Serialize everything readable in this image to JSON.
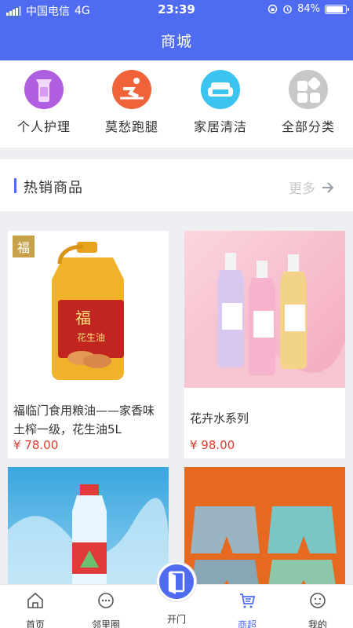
{
  "status_bar": {
    "carrier": "中国电信",
    "network": "4G",
    "time": "23:39",
    "battery": "84%",
    "battery_level": 0.84
  },
  "header": {
    "title": "商城"
  },
  "categories": [
    {
      "label": "个人护理",
      "icon": "bottle-icon",
      "color": "#b05ee0"
    },
    {
      "label": "莫愁跑腿",
      "icon": "runner-icon",
      "color": "#f0623a"
    },
    {
      "label": "家居清洁",
      "icon": "sofa-icon",
      "color": "#3cc4f0"
    },
    {
      "label": "全部分类",
      "icon": "grid-icon",
      "color": "#c8c8c8"
    }
  ],
  "hot_section": {
    "title": "热销商品",
    "more_label": "更多"
  },
  "products": [
    {
      "name": "福临门食用粮油——家香味土榨一级，花生油5L",
      "price": "¥ 78.00",
      "image_text": "花生油"
    },
    {
      "name": "花卉水系列",
      "price": "¥ 98.00"
    },
    {
      "name": "",
      "price": ""
    },
    {
      "name": "",
      "price": ""
    }
  ],
  "tabs": [
    {
      "label": "首页",
      "icon": "home-icon"
    },
    {
      "label": "邻里圈",
      "icon": "chat-icon"
    },
    {
      "label": "开门",
      "icon": "door-icon"
    },
    {
      "label": "商超",
      "icon": "cart-icon"
    },
    {
      "label": "我的",
      "icon": "profile-icon"
    }
  ],
  "colors": {
    "primary": "#4f6bf2",
    "price": "#e03a2c"
  }
}
